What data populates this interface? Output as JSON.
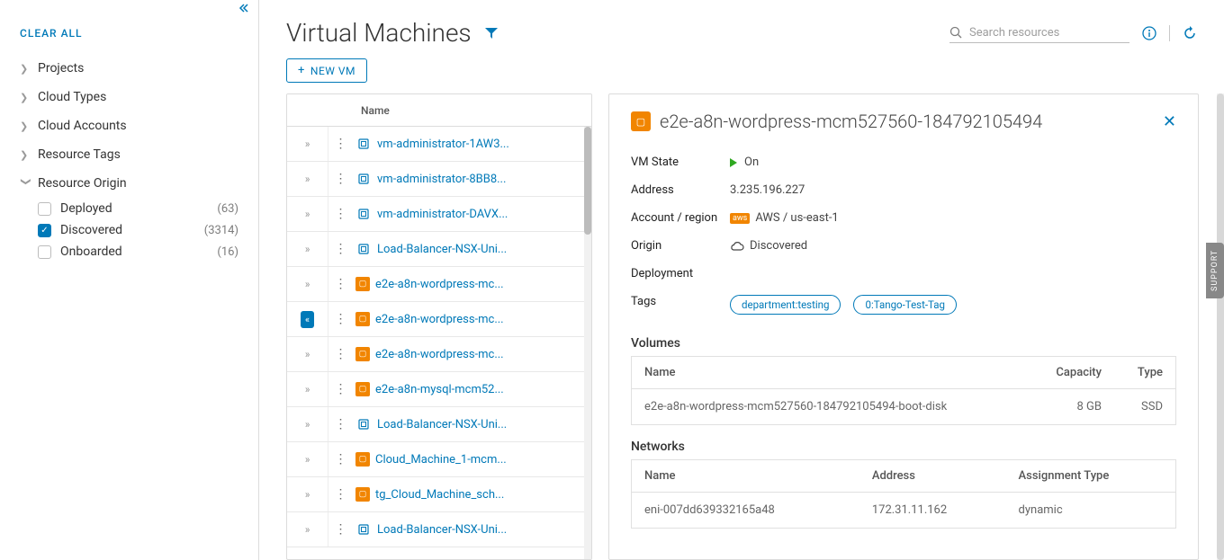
{
  "sidebar": {
    "clear_all": "CLEAR ALL",
    "filters": [
      {
        "label": "Projects",
        "expanded": false
      },
      {
        "label": "Cloud Types",
        "expanded": false
      },
      {
        "label": "Cloud Accounts",
        "expanded": false
      },
      {
        "label": "Resource Tags",
        "expanded": false
      },
      {
        "label": "Resource Origin",
        "expanded": true
      }
    ],
    "origin_options": [
      {
        "label": "Deployed",
        "checked": false,
        "count": "(63)"
      },
      {
        "label": "Discovered",
        "checked": true,
        "count": "(3314)"
      },
      {
        "label": "Onboarded",
        "checked": false,
        "count": "(16)"
      }
    ]
  },
  "header": {
    "title": "Virtual Machines",
    "search_placeholder": "Search resources",
    "new_vm": "NEW VM"
  },
  "list": {
    "name_header": "Name",
    "rows": [
      {
        "name": "vm-administrator-1AW3...",
        "orange": false,
        "selected": false
      },
      {
        "name": "vm-administrator-8BB8...",
        "orange": false,
        "selected": false
      },
      {
        "name": "vm-administrator-DAVX...",
        "orange": false,
        "selected": false
      },
      {
        "name": "Load-Balancer-NSX-Uni...",
        "orange": false,
        "selected": false
      },
      {
        "name": "e2e-a8n-wordpress-mc...",
        "orange": true,
        "selected": false
      },
      {
        "name": "e2e-a8n-wordpress-mc...",
        "orange": true,
        "selected": true
      },
      {
        "name": "e2e-a8n-wordpress-mc...",
        "orange": true,
        "selected": false
      },
      {
        "name": "e2e-a8n-mysql-mcm52...",
        "orange": true,
        "selected": false
      },
      {
        "name": "Load-Balancer-NSX-Uni...",
        "orange": false,
        "selected": false
      },
      {
        "name": "Cloud_Machine_1-mcm...",
        "orange": true,
        "selected": false
      },
      {
        "name": "tg_Cloud_Machine_sch...",
        "orange": true,
        "selected": false
      },
      {
        "name": "Load-Balancer-NSX-Uni...",
        "orange": false,
        "selected": false
      }
    ]
  },
  "detail": {
    "title": "e2e-a8n-wordpress-mcm527560-184792105494",
    "labels": {
      "vm_state": "VM State",
      "address": "Address",
      "account_region": "Account / region",
      "origin": "Origin",
      "deployment": "Deployment",
      "tags": "Tags",
      "volumes": "Volumes",
      "networks": "Networks"
    },
    "vm_state": "On",
    "address": "3.235.196.227",
    "account_region": "AWS / us-east-1",
    "origin": "Discovered",
    "tags": [
      "department:testing",
      "0:Tango-Test-Tag"
    ],
    "volumes": {
      "headers": {
        "name": "Name",
        "capacity": "Capacity",
        "type": "Type"
      },
      "rows": [
        {
          "name": "e2e-a8n-wordpress-mcm527560-184792105494-boot-disk",
          "capacity": "8 GB",
          "type": "SSD"
        }
      ]
    },
    "networks": {
      "headers": {
        "name": "Name",
        "address": "Address",
        "assign": "Assignment Type"
      },
      "rows": [
        {
          "name": "eni-007dd639332165a48",
          "address": "172.31.11.162",
          "assign": "dynamic"
        }
      ]
    }
  },
  "support_label": "SUPPORT"
}
